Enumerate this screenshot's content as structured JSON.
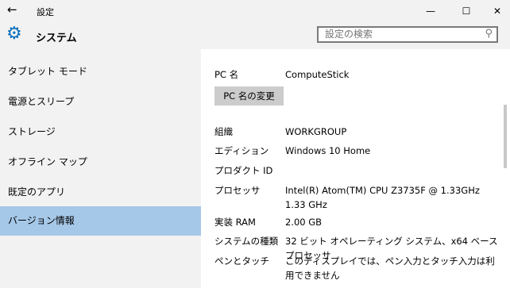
{
  "window": {
    "title": "設定",
    "back_glyph": "←",
    "minimize_glyph": "—",
    "maximize_glyph": "☐",
    "close_glyph": "✕"
  },
  "header": {
    "app_title": "システム",
    "search_placeholder": "設定の検索",
    "search_glyph": "⚲",
    "gear_glyph": "⚙"
  },
  "sidebar": {
    "items": [
      {
        "label": "タブレット モード",
        "active": false
      },
      {
        "label": "電源とスリープ",
        "active": false
      },
      {
        "label": "ストレージ",
        "active": false
      },
      {
        "label": "オフライン マップ",
        "active": false
      },
      {
        "label": "既定のアプリ",
        "active": false
      },
      {
        "label": "バージョン情報",
        "active": true
      }
    ]
  },
  "about": {
    "pc_name_label": "PC 名",
    "pc_name_value": "ComputeStick",
    "rename_button": "PC 名の変更",
    "rows": [
      {
        "label": "組織",
        "value": "WORKGROUP"
      },
      {
        "label": "エディション",
        "value": "Windows 10 Home"
      },
      {
        "label": "プロダクト ID",
        "value": ""
      },
      {
        "label": "プロセッサ",
        "value": "Intel(R) Atom(TM) CPU  Z3735F @ 1.33GHz   1.33 GHz"
      },
      {
        "label": "実装 RAM",
        "value": "2.00 GB"
      },
      {
        "label": "システムの種類",
        "value": "32 ビット オペレーティング システム、x64 ベース プロセッサ"
      },
      {
        "label": "ペンとタッチ",
        "value": "このディスプレイでは、ペン入力とタッチ入力は利用できません"
      }
    ]
  },
  "colors": {
    "accent": "#0a6ebd",
    "selected_bg": "#a6c8e8",
    "chrome_bg": "#f2f2f2"
  }
}
